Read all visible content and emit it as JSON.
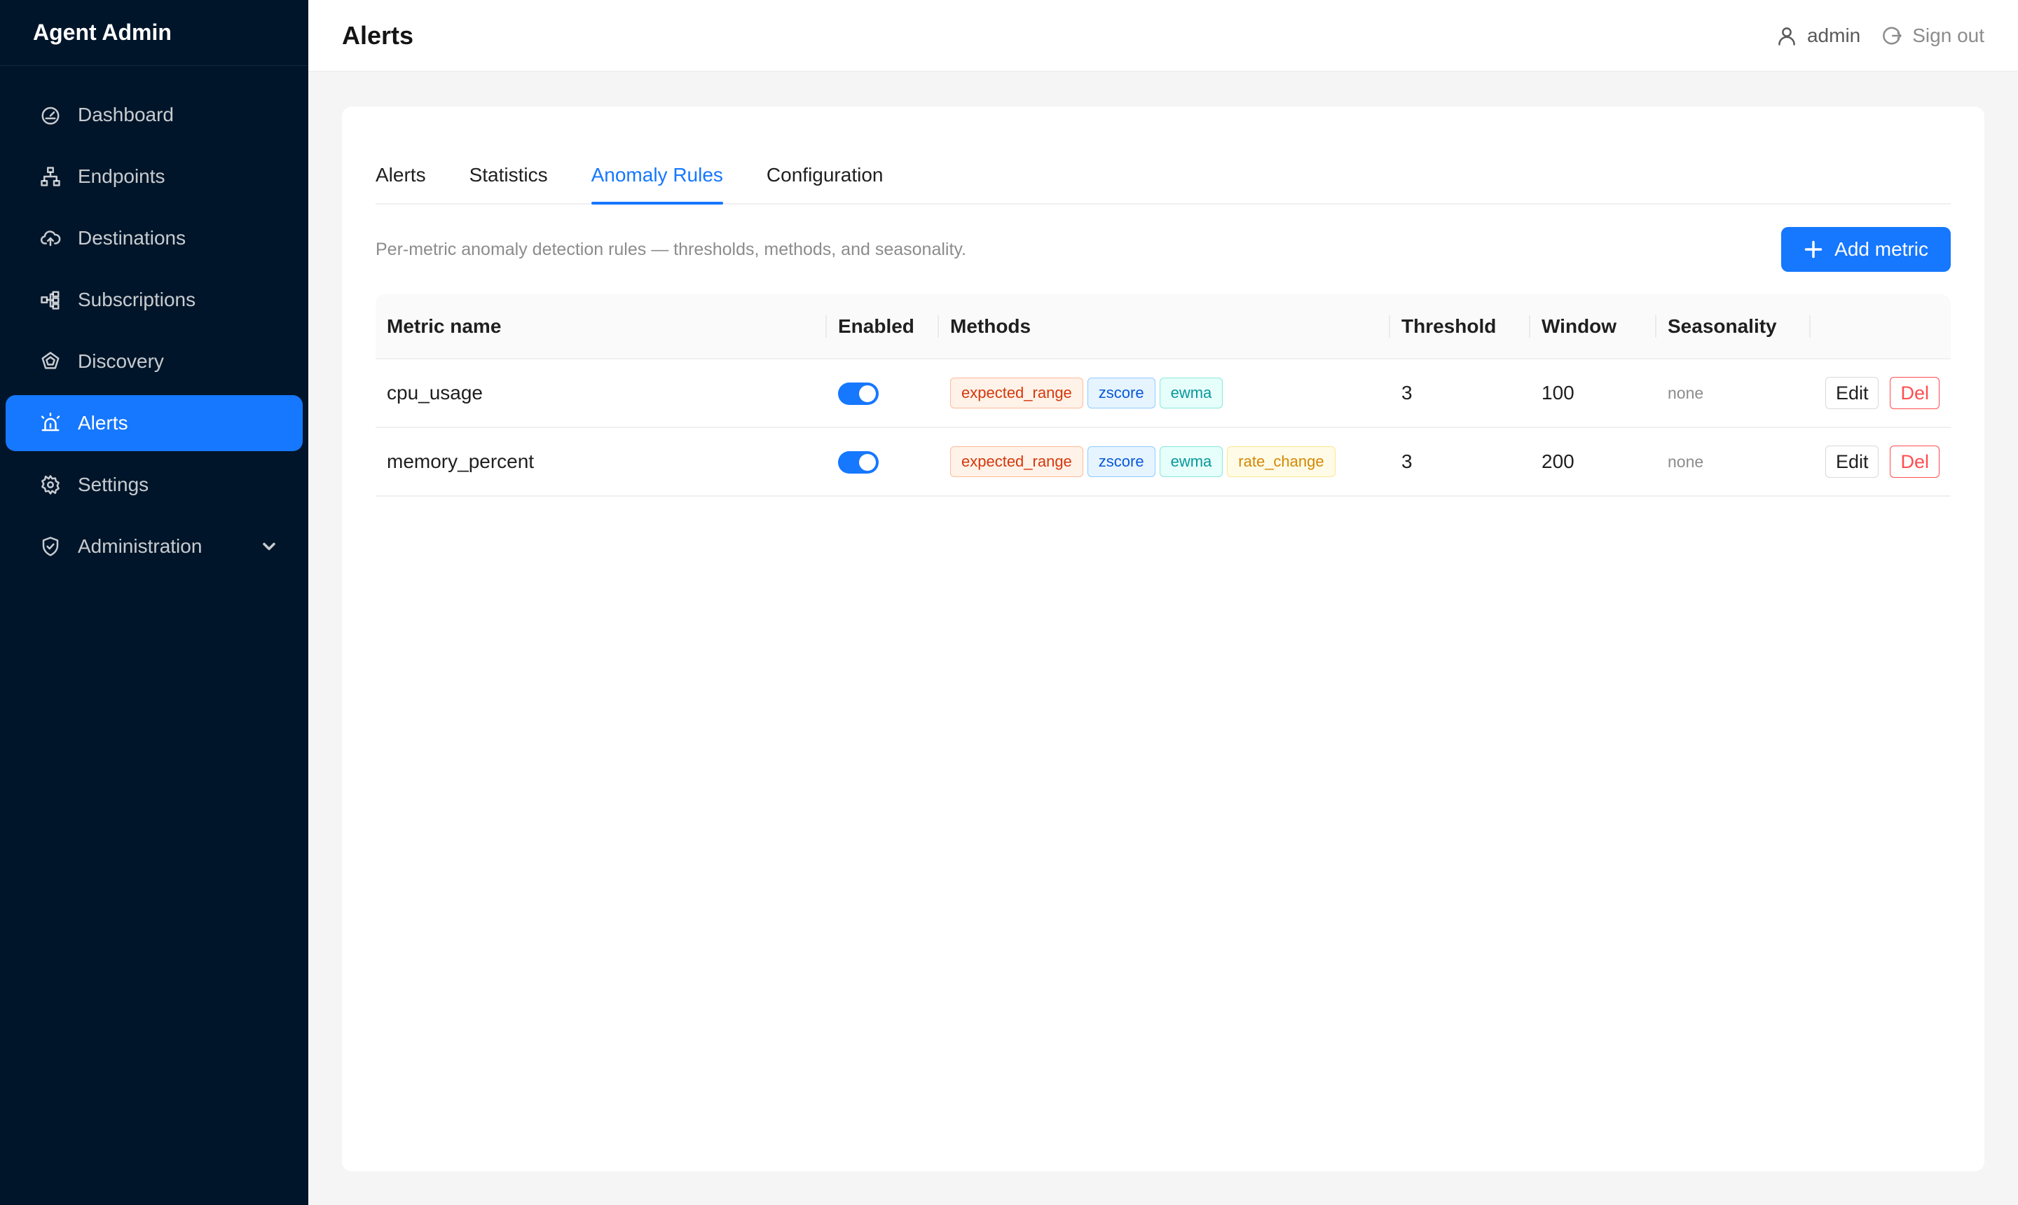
{
  "app": {
    "brand": "Agent Admin"
  },
  "sidebar": {
    "items": [
      {
        "label": "Dashboard",
        "icon": "dashboard-icon"
      },
      {
        "label": "Endpoints",
        "icon": "endpoints-icon"
      },
      {
        "label": "Destinations",
        "icon": "cloud-upload-icon"
      },
      {
        "label": "Subscriptions",
        "icon": "subscriptions-icon"
      },
      {
        "label": "Discovery",
        "icon": "discovery-icon"
      },
      {
        "label": "Alerts",
        "icon": "alert-icon",
        "active": true
      },
      {
        "label": "Settings",
        "icon": "gear-icon"
      },
      {
        "label": "Administration",
        "icon": "shield-icon",
        "expandable": true
      }
    ]
  },
  "header": {
    "title": "Alerts",
    "user": "admin",
    "signout": "Sign out"
  },
  "tabs": [
    {
      "label": "Alerts"
    },
    {
      "label": "Statistics"
    },
    {
      "label": "Anomaly Rules",
      "active": true
    },
    {
      "label": "Configuration"
    }
  ],
  "toolbar": {
    "description": "Per-metric anomaly detection rules — thresholds, methods, and seasonality.",
    "add_label": "Add metric"
  },
  "table": {
    "columns": {
      "metric": "Metric name",
      "enabled": "Enabled",
      "methods": "Methods",
      "threshold": "Threshold",
      "window": "Window",
      "seasonality": "Seasonality"
    },
    "rows": [
      {
        "metric": "cpu_usage",
        "enabled": true,
        "methods": [
          "expected_range",
          "zscore",
          "ewma"
        ],
        "threshold": "3",
        "window": "100",
        "seasonality": "none"
      },
      {
        "metric": "memory_percent",
        "enabled": true,
        "methods": [
          "expected_range",
          "zscore",
          "ewma",
          "rate_change"
        ],
        "threshold": "3",
        "window": "200",
        "seasonality": "none"
      }
    ],
    "edit_label": "Edit",
    "delete_label": "Del"
  },
  "colors": {
    "sidebar_bg": "#001529",
    "accent": "#1677ff",
    "danger": "#ff4d4f"
  }
}
